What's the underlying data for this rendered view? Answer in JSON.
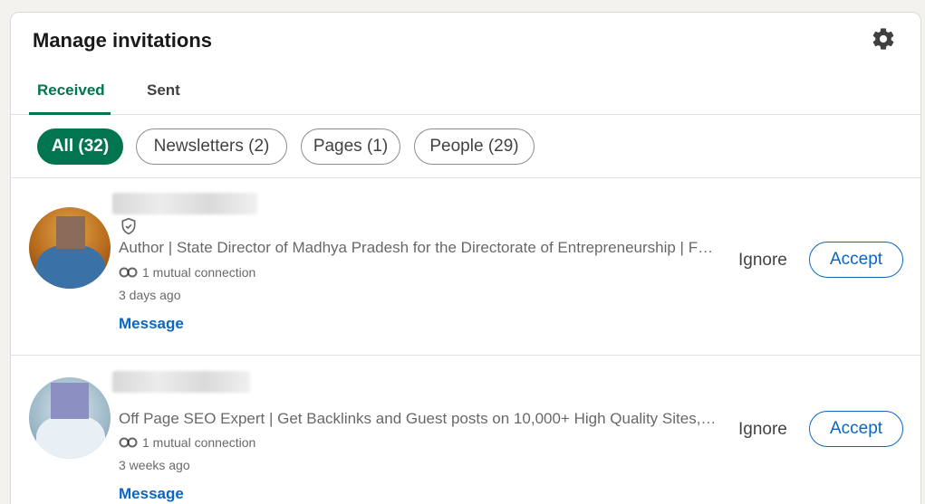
{
  "header": {
    "title": "Manage invitations",
    "settings_icon": "gear-icon"
  },
  "tabs": [
    {
      "label": "Received",
      "active": true
    },
    {
      "label": "Sent",
      "active": false
    }
  ],
  "filters": [
    {
      "label": "All (32)",
      "active": true
    },
    {
      "label": "Newsletters (2)",
      "active": false
    },
    {
      "label": "Pages (1)",
      "active": false
    },
    {
      "label": "People (29)",
      "active": false
    }
  ],
  "invitations": [
    {
      "headline": "Author | State Director of Madhya Pradesh for the Directorate of Entrepreneurship | Founder and Chief Executive Officer",
      "mutual": "1 mutual connection",
      "time": "3 days ago",
      "message_label": "Message",
      "ignore_label": "Ignore",
      "accept_label": "Accept",
      "verified": true
    },
    {
      "headline": "Off Page SEO Expert | Get Backlinks and Guest posts on 10,000+ High Quality Sites, Niche Edits and more",
      "mutual": "1 mutual connection",
      "time": "3 weeks ago",
      "message_label": "Message",
      "ignore_label": "Ignore",
      "accept_label": "Accept",
      "verified": false
    }
  ],
  "colors": {
    "accent_green": "#01754f",
    "link_blue": "#0a66c2",
    "background": "#f4f2ee"
  }
}
